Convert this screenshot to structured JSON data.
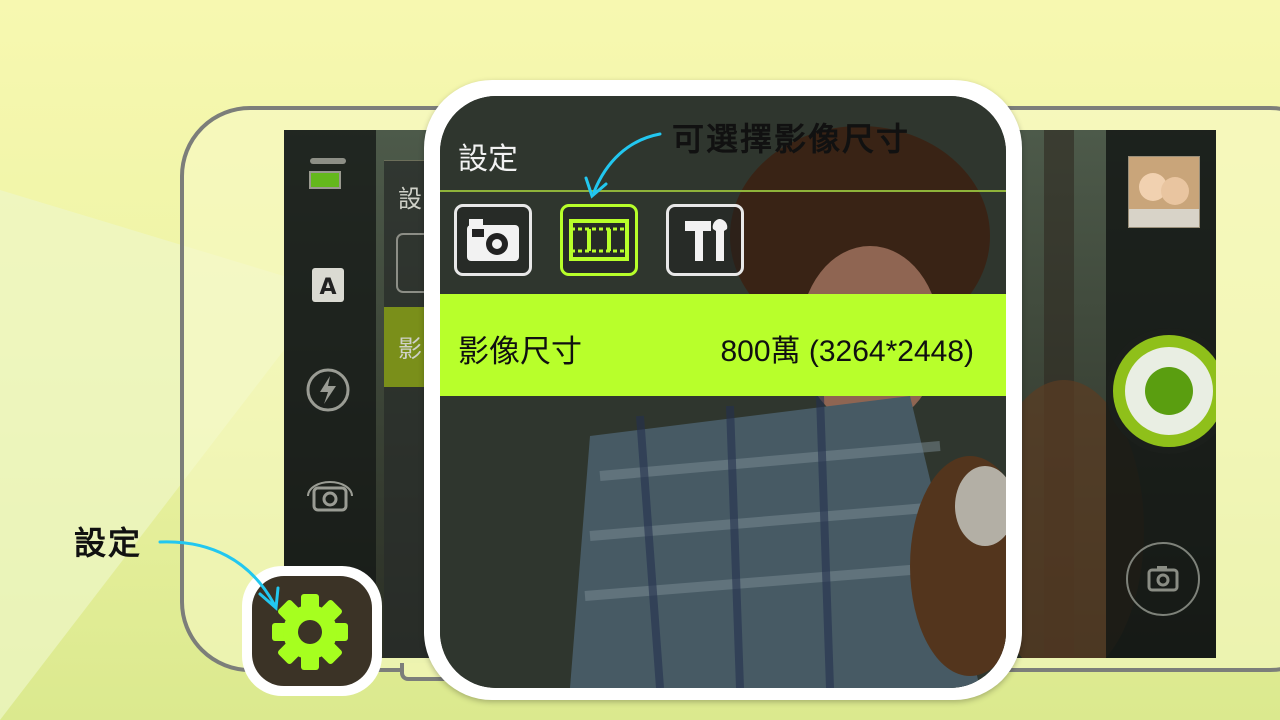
{
  "annotations": {
    "settings_callout": "設定",
    "image_size_callout": "可選擇影像尺寸"
  },
  "camera_screen": {
    "left_bar_icons": [
      "battery-icon",
      "scene-auto-icon",
      "flash-auto-icon",
      "switch-camera-icon"
    ],
    "behind_panel": {
      "title": "設",
      "row_label": "影"
    },
    "right_bar": {
      "thumbnail": "gallery-thumbnail",
      "shutter": "shutter-button",
      "mode": "camera-mode-icon"
    }
  },
  "settings_panel": {
    "title": "設定",
    "tabs": [
      {
        "icon": "camera-settings-icon",
        "active": false
      },
      {
        "icon": "film-strip-icon",
        "active": true
      },
      {
        "icon": "tools-icon",
        "active": false
      }
    ],
    "image_size": {
      "label": "影像尺寸",
      "value": "800萬 (3264*2448)"
    }
  },
  "colors": {
    "accent": "#b8ff2b",
    "arrow": "#22c7f0",
    "shutter_ring": "#8fc01a"
  }
}
